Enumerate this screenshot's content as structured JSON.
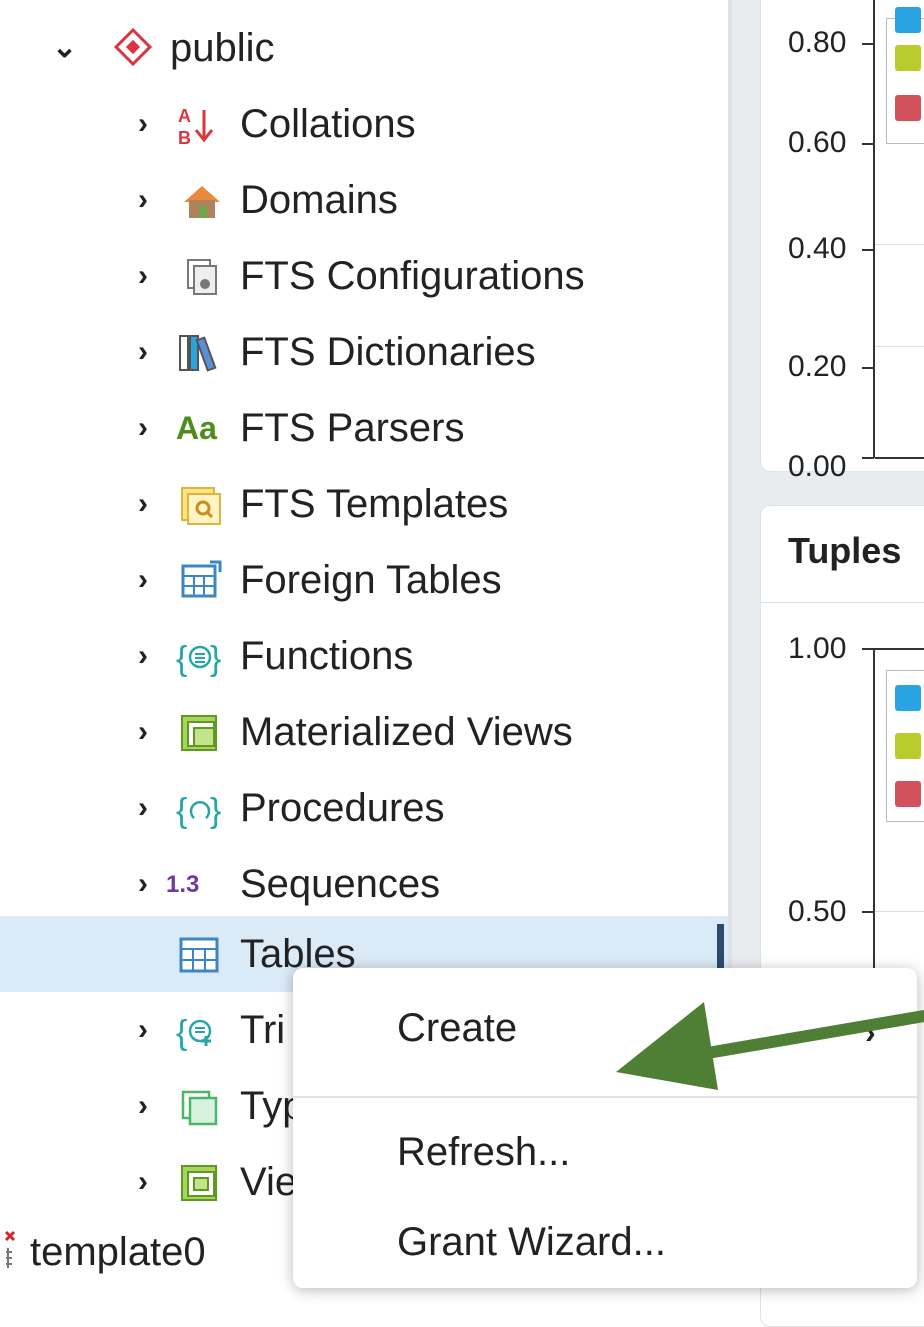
{
  "tree": {
    "schema": {
      "label": "public",
      "icon": "schema-icon"
    },
    "items": [
      {
        "label": "Collations",
        "icon": "collations-icon"
      },
      {
        "label": "Domains",
        "icon": "domains-icon"
      },
      {
        "label": "FTS Configurations",
        "icon": "fts-configurations-icon"
      },
      {
        "label": "FTS Dictionaries",
        "icon": "fts-dictionaries-icon"
      },
      {
        "label": "FTS Parsers",
        "icon": "fts-parsers-icon",
        "glyph": "Aa"
      },
      {
        "label": "FTS Templates",
        "icon": "fts-templates-icon"
      },
      {
        "label": "Foreign Tables",
        "icon": "foreign-tables-icon"
      },
      {
        "label": "Functions",
        "icon": "functions-icon"
      },
      {
        "label": "Materialized Views",
        "icon": "materialized-views-icon"
      },
      {
        "label": "Procedures",
        "icon": "procedures-icon"
      },
      {
        "label": "Sequences",
        "icon": "sequences-icon",
        "glyph": "1.3"
      },
      {
        "label": "Tables",
        "icon": "tables-icon",
        "selected": true
      },
      {
        "label": "Trigger Functions",
        "icon": "trigger-functions-icon",
        "visible_text": "Tri"
      },
      {
        "label": "Types",
        "icon": "types-icon",
        "visible_text": "Typ"
      },
      {
        "label": "Views",
        "icon": "views-icon",
        "visible_text": "Vie"
      }
    ],
    "database": {
      "label": "template0",
      "icon": "database-disconnected-icon"
    }
  },
  "dashboard": {
    "chart1": {
      "ticks": [
        "0.80",
        "0.60",
        "0.40",
        "0.20",
        "0.00"
      ]
    },
    "chart2": {
      "title": "Tuples",
      "ticks": [
        "1.00",
        "0.50"
      ]
    },
    "legend_colors": [
      "#29a3e1",
      "#b9cc2b",
      "#d1525c"
    ]
  },
  "context_menu": {
    "items": [
      {
        "label": "Create",
        "has_submenu": true
      },
      {
        "label": "Refresh..."
      },
      {
        "label": "Grant Wizard..."
      }
    ]
  },
  "annotation": {
    "arrow_color": "#4f7f35",
    "points_to": "Create"
  }
}
